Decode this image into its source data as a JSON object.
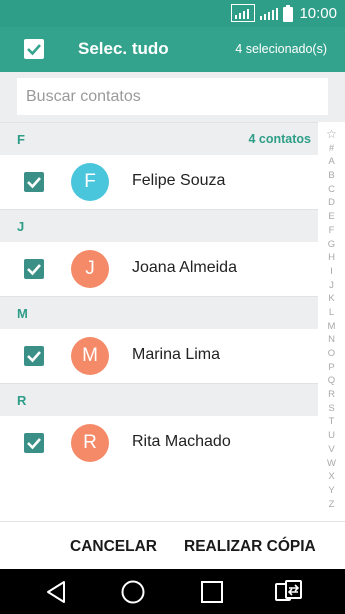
{
  "status_bar": {
    "time": "10:00"
  },
  "app_bar": {
    "title": "Selec. tudo",
    "selected_count": "4 selecionado(s)"
  },
  "search": {
    "placeholder": "Buscar contatos"
  },
  "sections": [
    {
      "letter": "F",
      "info": "4 contatos",
      "contacts": [
        {
          "initial": "F",
          "name": "Felipe Souza",
          "avatar_color": "#4ac6dc",
          "checked": true
        }
      ]
    },
    {
      "letter": "J",
      "info": "",
      "contacts": [
        {
          "initial": "J",
          "name": "Joana Almeida",
          "avatar_color": "#f48a68",
          "checked": true
        }
      ]
    },
    {
      "letter": "M",
      "info": "",
      "contacts": [
        {
          "initial": "M",
          "name": "Marina Lima",
          "avatar_color": "#f48a68",
          "checked": true
        }
      ]
    },
    {
      "letter": "R",
      "info": "",
      "contacts": [
        {
          "initial": "R",
          "name": "Rita Machado",
          "avatar_color": "#f48a68",
          "checked": true
        }
      ]
    }
  ],
  "index_bar": [
    "☆",
    "#",
    "A",
    "B",
    "C",
    "D",
    "E",
    "F",
    "G",
    "H",
    "I",
    "J",
    "K",
    "L",
    "M",
    "N",
    "O",
    "P",
    "Q",
    "R",
    "S",
    "T",
    "U",
    "V",
    "W",
    "X",
    "Y",
    "Z"
  ],
  "bottom_actions": {
    "cancel": "CANCELAR",
    "copy": "REALIZAR CÓPIA"
  },
  "colors": {
    "accent": "#34a38d",
    "status_bar": "#2f9e88",
    "checkbox": "#3a8f86",
    "section_bg": "#eceeef"
  },
  "icons": {
    "status": [
      "signal-icon",
      "signal-icon",
      "battery-icon"
    ],
    "nav": [
      "back-icon",
      "home-icon",
      "recents-icon",
      "switch-sim-icon"
    ]
  }
}
